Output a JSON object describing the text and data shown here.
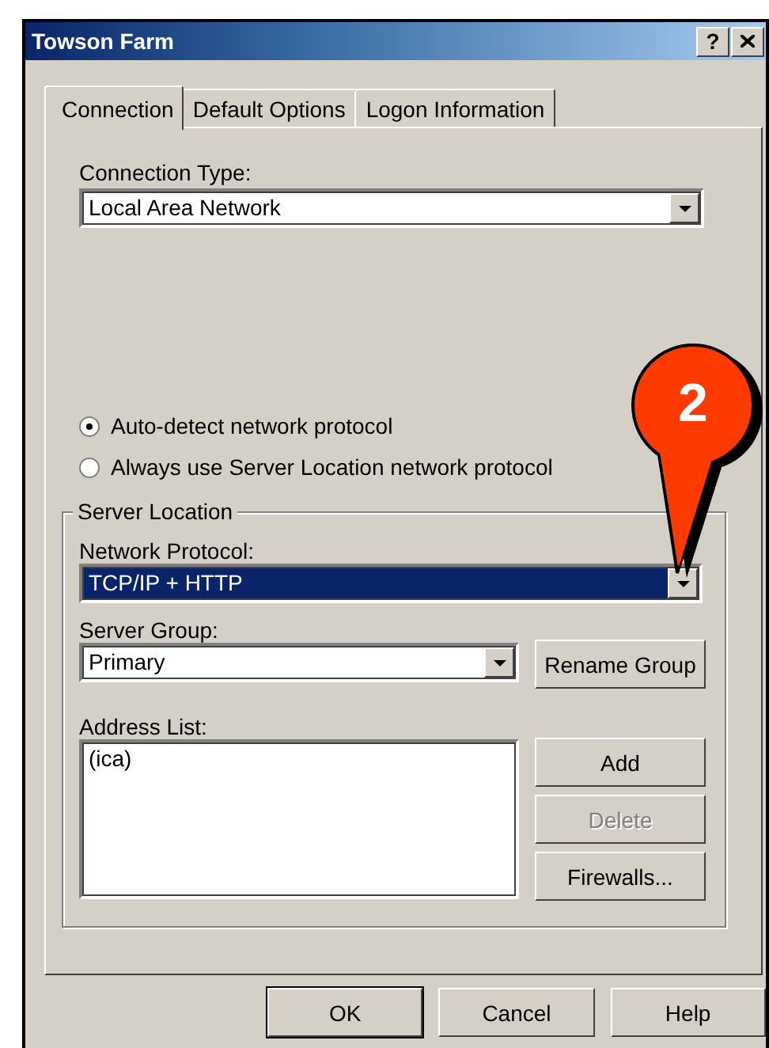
{
  "window": {
    "title": "Towson Farm",
    "help_button": "?"
  },
  "tabs": [
    {
      "label": "Connection",
      "selected": true
    },
    {
      "label": "Default Options",
      "selected": false
    },
    {
      "label": "Logon Information",
      "selected": false
    }
  ],
  "connection_type": {
    "label": "Connection Type:",
    "value": "Local Area Network"
  },
  "protocol_options": [
    {
      "label": "Auto-detect network protocol",
      "selected": true
    },
    {
      "label": "Always use Server Location network protocol",
      "selected": false
    }
  ],
  "server_location": {
    "title": "Server Location",
    "network_protocol": {
      "label": "Network Protocol:",
      "value": "TCP/IP + HTTP",
      "highlighted": true
    },
    "server_group": {
      "label": "Server Group:",
      "value": "Primary",
      "highlighted": false
    },
    "rename_button": "Rename Group",
    "address_list": {
      "label": "Address List:",
      "items": [
        "(ica)"
      ]
    },
    "list_buttons": [
      {
        "label": "Add",
        "disabled": false
      },
      {
        "label": "Delete",
        "disabled": true
      },
      {
        "label": "Firewalls...",
        "disabled": false
      }
    ]
  },
  "dialog_buttons": [
    {
      "label": "OK",
      "default": true
    },
    {
      "label": "Cancel",
      "default": false
    },
    {
      "label": "Help",
      "default": false
    }
  ],
  "callout": {
    "label": "2"
  }
}
